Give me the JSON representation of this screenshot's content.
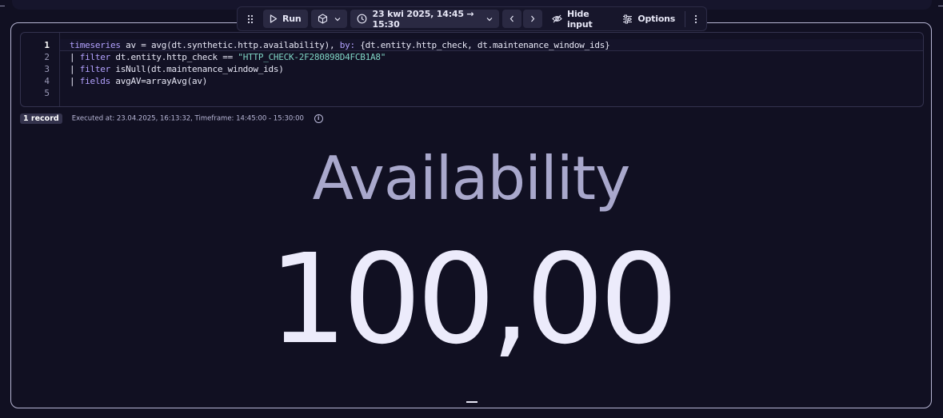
{
  "toolbar": {
    "run_label": "Run",
    "timeframe_label": "23 kwi 2025, 14:45 → 15:30",
    "hide_input_label": "Hide input",
    "options_label": "Options"
  },
  "editor": {
    "line_numbers": [
      "1",
      "2",
      "3",
      "4",
      "5"
    ],
    "lines": [
      [
        {
          "t": "timeseries",
          "c": "kw"
        },
        {
          "t": " av = avg(dt.synthetic.http.availability), "
        },
        {
          "t": "by:",
          "c": "kw"
        },
        {
          "t": " {dt.entity.http_check, dt.maintenance_window_ids}"
        }
      ],
      [
        {
          "t": "| "
        },
        {
          "t": "filter",
          "c": "kw"
        },
        {
          "t": " dt.entity.http_check == "
        },
        {
          "t": "\"HTTP_CHECK-2F280898D4FCB1A8\"",
          "c": "str"
        }
      ],
      [
        {
          "t": "| "
        },
        {
          "t": "filter",
          "c": "kw"
        },
        {
          "t": " isNull(dt.maintenance_window_ids)"
        }
      ],
      [
        {
          "t": "| "
        },
        {
          "t": "fields",
          "c": "kw"
        },
        {
          "t": " avgAV=arrayAvg(av)"
        }
      ],
      []
    ]
  },
  "result": {
    "record_count": "1 record",
    "executed_info": "Executed at: 23.04.2025, 16:13:32, Timeframe: 14:45:00 - 15:30:00"
  },
  "single_value": {
    "title": "Availability",
    "value": "100,00"
  },
  "colors": {
    "background": "#111022",
    "keyword": "#b3a2ff",
    "string": "#7fd4c4",
    "value": "#ecebfb",
    "title": "#a9a8cc"
  }
}
